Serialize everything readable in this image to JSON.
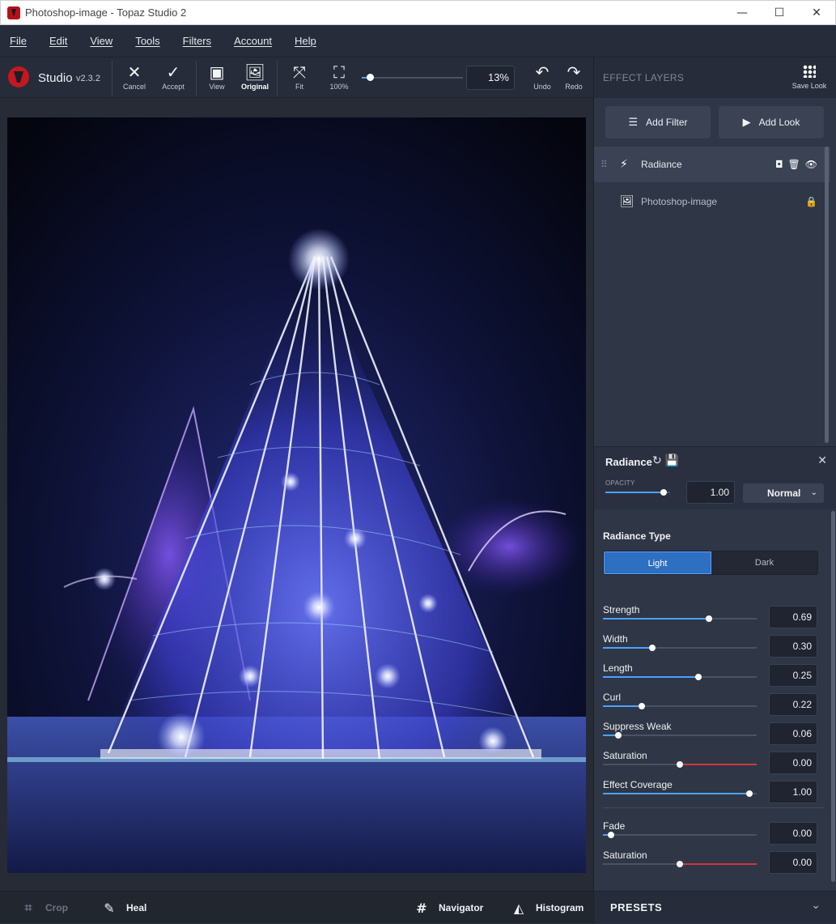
{
  "window": {
    "title": "Photoshop-image - Topaz Studio 2",
    "minimize_glyph": "—",
    "maximize_glyph": "☐",
    "close_glyph": "✕"
  },
  "menu": [
    "File",
    "Edit",
    "View",
    "Tools",
    "Filters",
    "Account",
    "Help"
  ],
  "toolbar": {
    "app_name": "Studio",
    "version": "v2.3.2",
    "cancel": "Cancel",
    "accept": "Accept",
    "view": "View",
    "original": "Original",
    "fit": "Fit",
    "hundred": "100%",
    "zoom_value": "13%",
    "zoom_level": 0.08,
    "undo": "Undo",
    "redo": "Redo"
  },
  "bottom_bar": {
    "crop": "Crop",
    "heal": "Heal",
    "navigator": "Navigator",
    "histogram": "Histogram"
  },
  "right_panel": {
    "header": "EFFECT LAYERS",
    "save_look": "Save Look",
    "add_filter": "Add Filter",
    "add_look": "Add Look",
    "layers": [
      {
        "name": "Radiance"
      },
      {
        "name": "Photoshop-image"
      }
    ],
    "effect": {
      "title": "Radiance",
      "opacity_label": "OPACITY",
      "opacity_value": "1.00",
      "opacity_level": 0.9,
      "blend_mode": "Normal"
    },
    "radiance_type": {
      "label": "Radiance Type",
      "options": [
        "Light",
        "Dark"
      ],
      "selected": "Light"
    },
    "params": [
      {
        "label": "Strength",
        "value": "0.69",
        "level": 0.69
      },
      {
        "label": "Width",
        "value": "0.30",
        "level": 0.32
      },
      {
        "label": "Length",
        "value": "0.25",
        "level": 0.62
      },
      {
        "label": "Curl",
        "value": "0.22",
        "level": 0.25
      },
      {
        "label": "Suppress Weak",
        "value": "0.06",
        "level": 0.1
      },
      {
        "label": "Saturation",
        "value": "0.00",
        "level": 0.5
      },
      {
        "label": "Effect Coverage",
        "value": "1.00",
        "level": 0.95
      }
    ],
    "params2": [
      {
        "label": "Fade",
        "value": "0.00",
        "level": 0.05
      },
      {
        "label": "Saturation",
        "value": "0.00",
        "level": 0.5
      }
    ],
    "presets": "PRESETS"
  },
  "colors": {
    "accent": "#4aa3ff",
    "saturation_negative": "#d0363d",
    "brand_red": "#c4171f"
  }
}
